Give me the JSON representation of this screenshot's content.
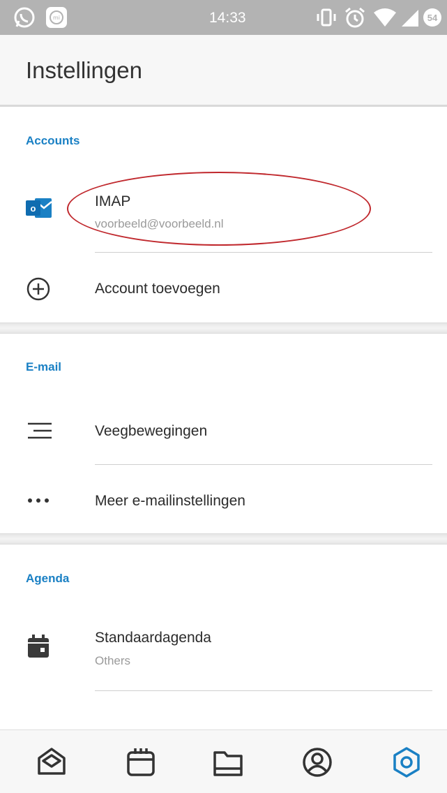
{
  "status_bar": {
    "time": "14:33",
    "battery": "54",
    "icons": [
      "whatsapp-icon",
      "mi-icon",
      "vibrate-icon",
      "alarm-icon",
      "wifi-icon",
      "signal-icon",
      "battery-icon"
    ]
  },
  "header": {
    "title": "Instellingen"
  },
  "sections": {
    "accounts": {
      "title": "Accounts",
      "account": {
        "name": "IMAP",
        "email": "voorbeeld@voorbeeld.nl",
        "icon": "outlook-icon"
      },
      "add": {
        "label": "Account toevoegen",
        "icon": "add-circle-icon"
      }
    },
    "email": {
      "title": "E-mail",
      "swipe": {
        "label": "Veegbewegingen",
        "icon": "swipe-lines-icon"
      },
      "more": {
        "label": "Meer e-mailinstellingen",
        "icon": "more-dots-icon"
      }
    },
    "agenda": {
      "title": "Agenda",
      "default": {
        "label": "Standaardagenda",
        "value": "Others",
        "icon": "calendar-icon"
      }
    }
  },
  "bottom_nav": {
    "items": [
      "mail-icon",
      "calendar-icon",
      "folder-icon",
      "people-icon",
      "settings-icon"
    ],
    "active": "settings-icon",
    "active_color": "#1a80c4"
  },
  "colors": {
    "accent": "#1a80c4",
    "annotation": "#c0282d",
    "status_bar": "#b3b3b3"
  }
}
